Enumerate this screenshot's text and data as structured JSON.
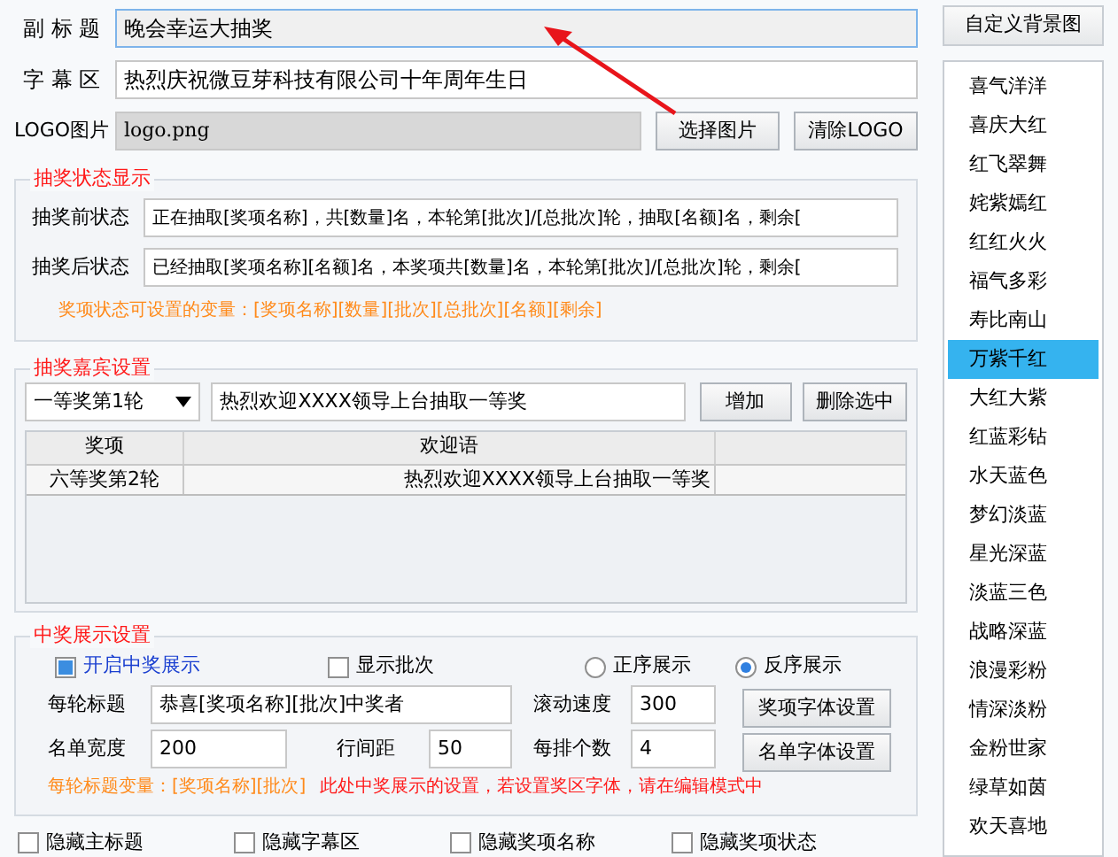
{
  "fields": [
    {
      "label": "副 标 题",
      "value": "晚会幸运大抽奖",
      "focused": true
    },
    {
      "label": "字 幕 区",
      "value": "热烈庆祝微豆芽科技有限公司十年周年生日",
      "focused": false
    }
  ],
  "logo": {
    "label": "LOGO图片",
    "value": "logo.png",
    "buttons": [
      "选择图片",
      "清除LOGO"
    ]
  },
  "status_group": {
    "title": "抽奖状态显示",
    "rows": [
      {
        "label": "抽奖前状态",
        "value": "正在抽取[奖项名称]，共[数量]名，本轮第[批次]/[总批次]轮，抽取[名额]名，剩余["
      },
      {
        "label": "抽奖后状态",
        "value": "已经抽取[奖项名称][名额]名，本奖项共[数量]名，本轮第[批次]/[总批次]轮，剩余["
      }
    ],
    "hint": "奖项状态可设置的变量：[奖项名称][数量][批次][总批次][名额][剩余]"
  },
  "guest_group": {
    "title": "抽奖嘉宾设置",
    "select": "一等奖第1轮",
    "welcome": "热烈欢迎XXXX领导上台抽取一等奖",
    "buttons": [
      "增加",
      "删除选中"
    ],
    "columns": [
      "奖项",
      "欢迎语"
    ],
    "rows": [
      {
        "cells": [
          "六等奖第2轮",
          "热烈欢迎XXXX领导上台抽取一等奖"
        ],
        "selected": false
      }
    ]
  },
  "display_group": {
    "title": "中奖展示设置",
    "checks": [
      {
        "label": "开启中奖展示",
        "checked": true
      },
      {
        "label": "显示批次",
        "checked": false
      }
    ],
    "radios": [
      {
        "label": "正序展示",
        "selected": false
      },
      {
        "label": "反序展示",
        "selected": true
      }
    ],
    "round_title": {
      "label": "每轮标题",
      "value": "恭喜[奖项名称][批次]中奖者"
    },
    "scroll_speed": {
      "label": "滚动速度",
      "value": "300"
    },
    "list_width": {
      "label": "名单宽度",
      "value": "200"
    },
    "line_spacing": {
      "label": "行间距",
      "value": "50"
    },
    "per_row": {
      "label": "每排个数",
      "value": "4"
    },
    "buttons": [
      "奖项字体设置",
      "名单字体设置"
    ],
    "hint": "每轮标题变量：[奖项名称][批次]",
    "note": "此处中奖展示的设置，若设置奖区字体，请在编辑模式中"
  },
  "bottom_checks": [
    {
      "label": "隐藏主标题",
      "checked": false
    },
    {
      "label": "隐藏字幕区",
      "checked": false
    },
    {
      "label": "隐藏奖项名称",
      "checked": false
    },
    {
      "label": "隐藏奖项状态",
      "checked": false
    }
  ],
  "sidebar": {
    "button": "自定义背景图",
    "themes": [
      {
        "label": "喜气洋洋",
        "selected": false
      },
      {
        "label": "喜庆大红",
        "selected": false
      },
      {
        "label": "红飞翠舞",
        "selected": false
      },
      {
        "label": "姹紫嫣红",
        "selected": false
      },
      {
        "label": "红红火火",
        "selected": false
      },
      {
        "label": "福气多彩",
        "selected": false
      },
      {
        "label": "寿比南山",
        "selected": false
      },
      {
        "label": "万紫千红",
        "selected": true
      },
      {
        "label": "大红大紫",
        "selected": false
      },
      {
        "label": "红蓝彩钻",
        "selected": false
      },
      {
        "label": "水天蓝色",
        "selected": false
      },
      {
        "label": "梦幻淡蓝",
        "selected": false
      },
      {
        "label": "星光深蓝",
        "selected": false
      },
      {
        "label": "淡蓝三色",
        "selected": false
      },
      {
        "label": "战略深蓝",
        "selected": false
      },
      {
        "label": "浪漫彩粉",
        "selected": false
      },
      {
        "label": "情深淡粉",
        "selected": false
      },
      {
        "label": "金粉世家",
        "selected": false
      },
      {
        "label": "绿草如茵",
        "selected": false
      },
      {
        "label": "欢天喜地",
        "selected": false
      }
    ]
  }
}
